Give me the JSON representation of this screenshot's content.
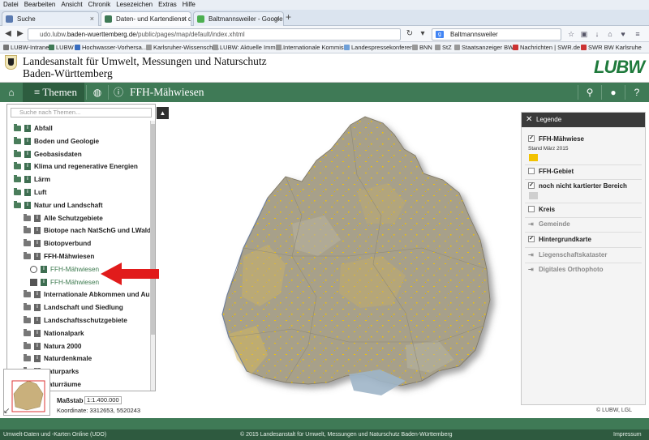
{
  "browser": {
    "menu": [
      "Datei",
      "Bearbeiten",
      "Ansicht",
      "Chronik",
      "Lesezeichen",
      "Extras",
      "Hilfe"
    ],
    "tabs": [
      {
        "label": "Suche"
      },
      {
        "label": "Daten- und Kartendienst d..."
      },
      {
        "label": "Baltmannsweiler - Google ..."
      }
    ],
    "url_prefix": "udo.lubw.",
    "url_host": "baden-wuerttemberg.de",
    "url_path": "/public/pages/map/default/index.xhtml",
    "search_value": "Baltmannsweiler",
    "bookmarks": [
      "LUBW-Intranet",
      "LUBW",
      "Hochwasser-Vorhersa...",
      "Karlsruher-Wissenscha...",
      "LUBW: Aktuelle Immis...",
      "Internationale Kommis...",
      "Landespressekonferen...",
      "BNN",
      "StZ",
      "Staatsanzeiger BW",
      "Nachrichten | SWR.de",
      "SWR BW Karlsruhe"
    ]
  },
  "header": {
    "title_line1": "Landesanstalt für Umwelt, Messungen und Naturschutz",
    "title_line2": "Baden-Württemberg",
    "logo": "LUBW"
  },
  "toolbar": {
    "themen_label": "Themen",
    "page_title": "FFH-Mähwiesen"
  },
  "themes": {
    "search_placeholder": "Suche nach Themen...",
    "items": [
      {
        "label": "Abfall",
        "level": 0
      },
      {
        "label": "Boden und Geologie",
        "level": 0
      },
      {
        "label": "Geobasisdaten",
        "level": 0
      },
      {
        "label": "Klima und regenerative Energien",
        "level": 0
      },
      {
        "label": "Lärm",
        "level": 0
      },
      {
        "label": "Luft",
        "level": 0
      },
      {
        "label": "Natur und Landschaft",
        "level": 0
      },
      {
        "label": "Alle Schutzgebiete",
        "level": 1
      },
      {
        "label": "Biotope nach NatSchG und LWaldG",
        "level": 1
      },
      {
        "label": "Biotopverbund",
        "level": 1
      },
      {
        "label": "FFH-Mähwiesen",
        "level": 1
      },
      {
        "label": "FFH-Mähwiesen",
        "level": 2,
        "kind": "active"
      },
      {
        "label": "FFH-Mähwiesen",
        "level": 2,
        "kind": "download"
      },
      {
        "label": "Internationale Abkommen und Ausze",
        "level": 1
      },
      {
        "label": "Landschaft und Siedlung",
        "level": 1
      },
      {
        "label": "Landschaftsschutzgebiete",
        "level": 1
      },
      {
        "label": "Nationalpark",
        "level": 1
      },
      {
        "label": "Natura 2000",
        "level": 1
      },
      {
        "label": "Naturdenkmale",
        "level": 1
      },
      {
        "label": "Naturparks",
        "level": 1
      },
      {
        "label": "Naturräume",
        "level": 1
      }
    ]
  },
  "map": {
    "scale_label": "Maßstab",
    "scale_value": "1:1.400.000",
    "coord_text": "Koordinate: 3312653, 5520243"
  },
  "legend": {
    "title": "Legende",
    "rows": [
      {
        "label": "FFH-Mähwiese",
        "checked": true,
        "dim": false
      },
      {
        "label": "FFH-Gebiet",
        "checked": false,
        "dim": false
      },
      {
        "label": "noch nicht kartierter Bereich",
        "checked": true,
        "dim": false
      },
      {
        "label": "Kreis",
        "checked": false,
        "dim": false
      },
      {
        "label": "Gemeinde",
        "checked": false,
        "dim": true
      },
      {
        "label": "Hintergrundkarte",
        "checked": true,
        "dim": false
      },
      {
        "label": "Liegenschaftskataster",
        "checked": false,
        "dim": true
      },
      {
        "label": "Digitales Orthophoto",
        "checked": false,
        "dim": true
      }
    ],
    "stand": "Stand März 2015",
    "swatch_mahwiese": "#f2c200",
    "swatch_unmapped": "#cfcfcf",
    "credit": "© LUBW, LGL"
  },
  "footer": {
    "left": "Umwelt-Daten und -Karten Online (UDO)",
    "center": "© 2015 Landesanstalt für Umwelt, Messungen und Naturschutz Baden-Württemberg",
    "right": "Impressum"
  },
  "colors": {
    "green_bar": "#3f7a56",
    "green_dark": "#2d5d3f",
    "map_land": "#a7a08a",
    "mahwiese": "#f2c200"
  }
}
